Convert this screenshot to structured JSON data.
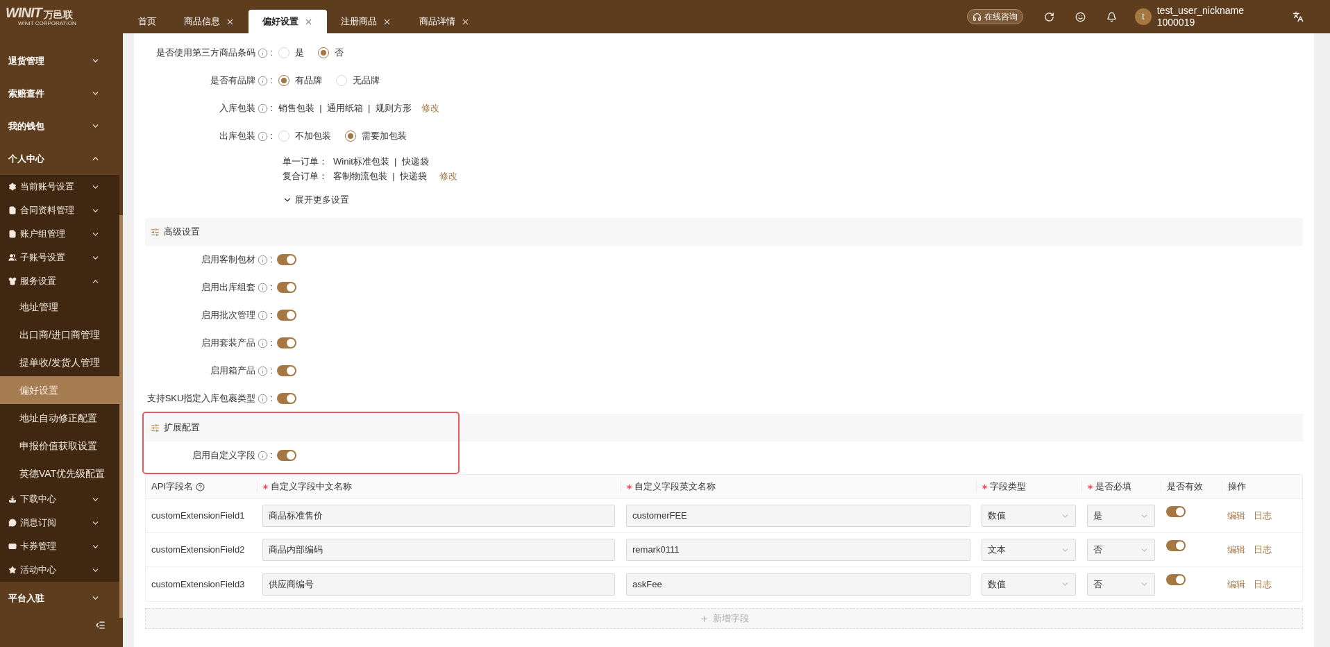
{
  "header": {
    "logo_text": "WINIT",
    "logo_cn": "万邑联",
    "logo_sub": "WINIT CORPORATION",
    "tabs": [
      {
        "label": "首页",
        "closable": false,
        "selected": false
      },
      {
        "label": "商品信息",
        "closable": true,
        "selected": false
      },
      {
        "label": "偏好设置",
        "closable": true,
        "selected": true
      },
      {
        "label": "注册商品",
        "closable": true,
        "selected": false
      },
      {
        "label": "商品详情",
        "closable": true,
        "selected": false
      }
    ],
    "consult": "在线咨询",
    "avatar": "t",
    "username": "test_user_nickname",
    "user_id": "1000019"
  },
  "sidebar": {
    "items": [
      {
        "label": "退货管理",
        "expanded": false
      },
      {
        "label": "索赔查件",
        "expanded": false
      },
      {
        "label": "我的钱包",
        "expanded": false
      },
      {
        "label": "个人中心",
        "expanded": true,
        "children": [
          {
            "label": "当前账号设置",
            "expanded": false
          },
          {
            "label": "合同资料管理",
            "expanded": false
          },
          {
            "label": "账户组管理",
            "expanded": false
          },
          {
            "label": "子账号设置",
            "expanded": false
          },
          {
            "label": "服务设置",
            "expanded": true,
            "children": [
              {
                "label": "地址管理",
                "selected": false
              },
              {
                "label": "出口商/进口商管理",
                "selected": false
              },
              {
                "label": "提单收/发货人管理",
                "selected": false
              },
              {
                "label": "偏好设置",
                "selected": true
              },
              {
                "label": "地址自动修正配置",
                "selected": false
              },
              {
                "label": "申报价值获取设置",
                "selected": false
              },
              {
                "label": "英德VAT优先级配置",
                "selected": false
              }
            ]
          },
          {
            "label": "下载中心",
            "expanded": false
          },
          {
            "label": "消息订阅",
            "expanded": false
          },
          {
            "label": "卡券管理",
            "expanded": false
          },
          {
            "label": "活动中心",
            "expanded": false
          }
        ]
      },
      {
        "label": "平台入驻",
        "expanded": false
      }
    ]
  },
  "basic_settings": [
    {
      "kind": "radio",
      "label": "是否使用第三方商品条码",
      "separator": ":",
      "options": [
        {
          "label": "是",
          "selected": false
        },
        {
          "label": "否",
          "selected": true
        }
      ]
    },
    {
      "kind": "radio",
      "label": "是否有品牌",
      "separator": ":",
      "options": [
        {
          "label": "有品牌",
          "selected": true
        },
        {
          "label": "无品牌",
          "selected": false
        }
      ]
    },
    {
      "kind": "summary",
      "label": "入库包装",
      "separator": ":",
      "value": "销售包装  |  通用纸箱  |  规则方形",
      "link": "修改"
    },
    {
      "kind": "radio",
      "label": "出库包装",
      "separator": ":",
      "options": [
        {
          "label": "不加包装",
          "selected": false
        },
        {
          "label": "需要加包装",
          "selected": true
        }
      ]
    }
  ],
  "outbound_details": [
    {
      "label": "单一订单：",
      "value": "Winit标准包装  |  快递袋"
    },
    {
      "label": "复合订单：",
      "value": "客制物流包装  |  快递袋",
      "link": "修改"
    }
  ],
  "expand_link": "展开更多设置",
  "advanced": {
    "title": "高级设置",
    "toggles": [
      {
        "label": "启用客制包材",
        "separator": ":",
        "on": true
      },
      {
        "label": "启用出库组套",
        "separator": ":",
        "on": true
      },
      {
        "label": "启用批次管理",
        "separator": ":",
        "on": true
      },
      {
        "label": "启用套装产品",
        "separator": ":",
        "on": true
      },
      {
        "label": "启用箱产品",
        "separator": ":",
        "on": true
      },
      {
        "label": "支持SKU指定入库包裹类型",
        "separator": ":",
        "on": true
      }
    ]
  },
  "extension": {
    "title": "扩展配置",
    "highlighted": true,
    "toggles": [
      {
        "label": "启用自定义字段",
        "separator": ":",
        "on": true
      }
    ]
  },
  "fields_table": {
    "columns": [
      {
        "label": "API字段名",
        "required": false,
        "help": true
      },
      {
        "label": "自定义字段中文名称",
        "required": true,
        "help": false
      },
      {
        "label": "自定义字段英文名称",
        "required": true,
        "help": false
      },
      {
        "label": "字段类型",
        "required": true,
        "help": false
      },
      {
        "label": "是否必填",
        "required": true,
        "help": false
      },
      {
        "label": "是否有效",
        "required": false,
        "help": false
      },
      {
        "label": "操作",
        "required": false,
        "help": false
      }
    ],
    "rows": [
      {
        "api_name": "customExtensionField1",
        "cn_name": "商品标准售价",
        "en_name": "customerFEE",
        "type": "数值",
        "required": "是",
        "valid": true,
        "actions": [
          "编辑",
          "日志"
        ]
      },
      {
        "api_name": "customExtensionField2",
        "cn_name": "商品内部编码",
        "en_name": "remark0111",
        "type": "文本",
        "required": "否",
        "valid": true,
        "actions": [
          "编辑",
          "日志"
        ]
      },
      {
        "api_name": "customExtensionField3",
        "cn_name": "供应商编号",
        "en_name": "askFee",
        "type": "数值",
        "required": "否",
        "valid": true,
        "actions": [
          "编辑",
          "日志"
        ]
      }
    ],
    "add_button": "新增字段"
  }
}
